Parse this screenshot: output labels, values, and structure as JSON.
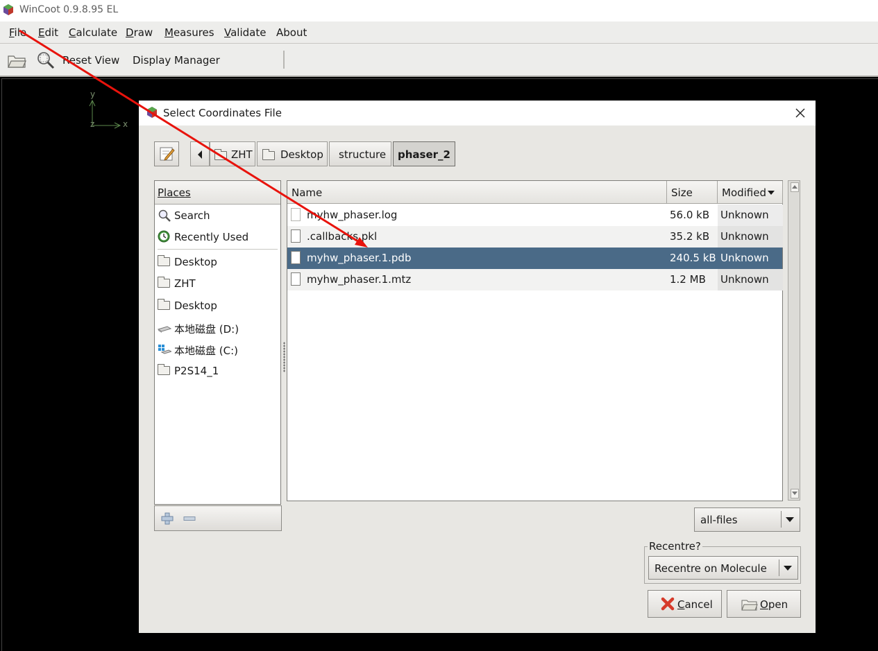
{
  "app": {
    "title": "WinCoot 0.9.8.95 EL"
  },
  "menubar": {
    "items": [
      {
        "mnemonic": "F",
        "rest": "ile"
      },
      {
        "mnemonic": "E",
        "rest": "dit"
      },
      {
        "mnemonic": "C",
        "rest": "alculate"
      },
      {
        "mnemonic": "D",
        "rest": "raw"
      },
      {
        "mnemonic": "M",
        "rest": "easures"
      },
      {
        "mnemonic": "V",
        "rest": "alidate"
      },
      {
        "mnemonic": "",
        "rest": "About"
      }
    ]
  },
  "toolbar": {
    "reset_view": "Reset View",
    "display_manager": "Display Manager"
  },
  "axes": {
    "y": "y",
    "x": "x",
    "z": "z"
  },
  "dialog": {
    "title": "Select Coordinates File",
    "path": [
      "ZHT",
      "Desktop",
      "structure",
      "phaser_2"
    ],
    "places_header": "Places",
    "places": [
      {
        "label": "Search",
        "icon": "search-icon"
      },
      {
        "label": "Recently Used",
        "icon": "recent-icon"
      },
      {
        "label": "Desktop",
        "icon": "folder-icon"
      },
      {
        "label": "ZHT",
        "icon": "folder-icon"
      },
      {
        "label": "Desktop",
        "icon": "folder-icon"
      },
      {
        "label": "本地磁盘 (D:)",
        "icon": "drive-icon"
      },
      {
        "label": "本地磁盘 (C:)",
        "icon": "windows-drive-icon"
      },
      {
        "label": "P2S14_1",
        "icon": "folder-icon"
      }
    ],
    "columns": {
      "name": "Name",
      "size": "Size",
      "modified": "Modified"
    },
    "files": [
      {
        "name": "myhw_phaser.log",
        "size": "56.0 kB",
        "modified": "Unknown",
        "selected": false
      },
      {
        "name": ".callbacks.pkl",
        "size": "35.2 kB",
        "modified": "Unknown",
        "selected": false
      },
      {
        "name": "myhw_phaser.1.pdb",
        "size": "240.5 kB",
        "modified": "Unknown",
        "selected": true
      },
      {
        "name": "myhw_phaser.1.mtz",
        "size": "1.2 MB",
        "modified": "Unknown",
        "selected": false
      }
    ],
    "filter": "all-files",
    "recentre_label": "Recentre?",
    "recentre_value": "Recentre on Molecule",
    "cancel": {
      "mnemonic": "C",
      "rest": "ancel"
    },
    "open": {
      "mnemonic": "O",
      "rest": "pen"
    }
  },
  "colors": {
    "selection": "#4a6a87",
    "annotation_arrow": "#e8130c",
    "gl_background": "#000000"
  }
}
